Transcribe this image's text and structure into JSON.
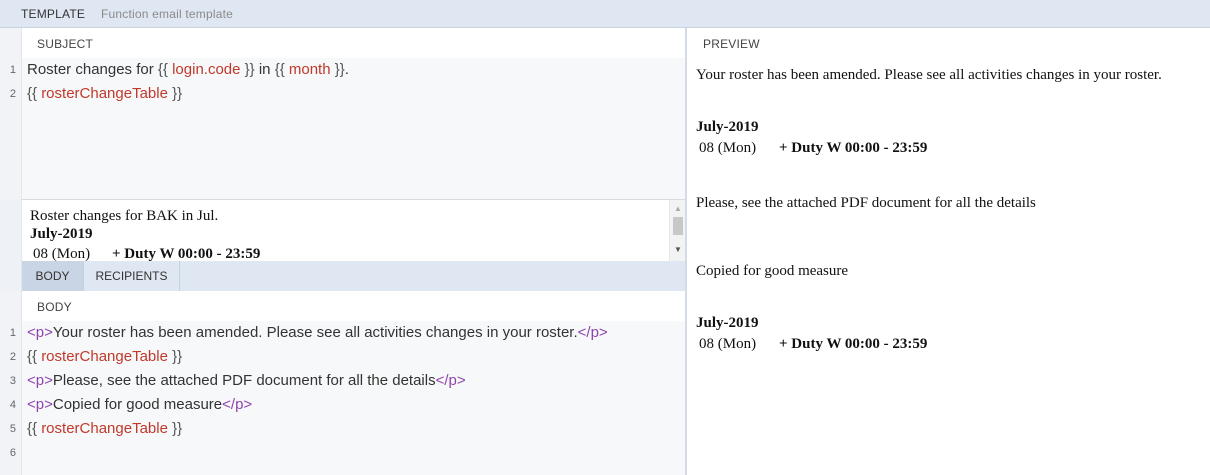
{
  "topbar": {
    "active_tab": "TEMPLATE",
    "subtitle": "Function email template"
  },
  "subject": {
    "header": "SUBJECT",
    "lines": [
      {
        "num": "1",
        "parts": [
          {
            "t": "Roster changes for ",
            "c": "text"
          },
          {
            "t": "{{ ",
            "c": "mustache"
          },
          {
            "t": "login.code",
            "c": "var"
          },
          {
            "t": " }}",
            "c": "mustache"
          },
          {
            "t": " in ",
            "c": "text"
          },
          {
            "t": "{{ ",
            "c": "mustache"
          },
          {
            "t": "month",
            "c": "var"
          },
          {
            "t": " }}",
            "c": "mustache"
          },
          {
            "t": ".",
            "c": "text"
          }
        ]
      },
      {
        "num": "2",
        "parts": [
          {
            "t": "{{ ",
            "c": "mustache"
          },
          {
            "t": "rosterChangeTable",
            "c": "var"
          },
          {
            "t": " }}",
            "c": "mustache"
          }
        ]
      }
    ],
    "preview": {
      "line1": "Roster changes for BAK in Jul.",
      "month": "July-2019",
      "day": "08 (Mon)",
      "duty": "+ Duty W 00:00 - 23:59"
    }
  },
  "subtabs": {
    "body": "BODY",
    "recipients": "RECIPIENTS"
  },
  "body": {
    "header": "BODY",
    "lines": [
      {
        "num": "1",
        "parts": [
          {
            "t": "<p>",
            "c": "tag"
          },
          {
            "t": "Your roster has been amended. Please see all activities changes in your roster.",
            "c": "text"
          },
          {
            "t": "</p>",
            "c": "tag"
          }
        ]
      },
      {
        "num": "2",
        "parts": [
          {
            "t": "{{ ",
            "c": "mustache"
          },
          {
            "t": "rosterChangeTable",
            "c": "var"
          },
          {
            "t": " }}",
            "c": "mustache"
          }
        ]
      },
      {
        "num": "3",
        "parts": [
          {
            "t": "<p>",
            "c": "tag"
          },
          {
            "t": "Please, see the attached PDF document for all the details",
            "c": "text"
          },
          {
            "t": "</p>",
            "c": "tag"
          }
        ]
      },
      {
        "num": "4",
        "parts": [
          {
            "t": "<p>",
            "c": "tag"
          },
          {
            "t": "Copied for good measure",
            "c": "text"
          },
          {
            "t": "</p>",
            "c": "tag"
          }
        ]
      },
      {
        "num": "5",
        "parts": [
          {
            "t": "{{ ",
            "c": "mustache"
          },
          {
            "t": "rosterChangeTable",
            "c": "var"
          },
          {
            "t": " }}",
            "c": "mustache"
          }
        ]
      },
      {
        "num": "6",
        "parts": []
      }
    ]
  },
  "preview": {
    "header": "PREVIEW",
    "para1": "Your roster has been amended. Please see all activities changes in your roster.",
    "table1": {
      "month": "July-2019",
      "day": "08 (Mon)",
      "duty": "+ Duty W 00:00 - 23:59"
    },
    "para2": "Please, see the attached PDF document for all the details",
    "para3": "Copied for good measure",
    "table2": {
      "month": "July-2019",
      "day": "08 (Mon)",
      "duty": "+ Duty W 00:00 - 23:59"
    }
  }
}
